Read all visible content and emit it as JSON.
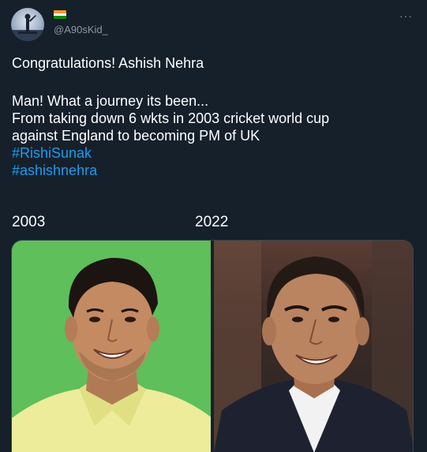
{
  "user": {
    "handle": "@A90sKid_",
    "flag": [
      "#ff9933",
      "#ffffff",
      "#138808"
    ],
    "more_label": "···"
  },
  "tweet": {
    "lines": [
      "Congratulations! Ashish Nehra",
      "Man! What a journey its been...",
      "From taking down 6 wkts in 2003 cricket world cup",
      "against England to becoming PM of UK"
    ],
    "hashtags": [
      "#RishiSunak",
      "#ashishnehra"
    ]
  },
  "media": {
    "left_label": "2003",
    "right_label": "2022"
  },
  "colors": {
    "background": "#15202b",
    "hashtag": "#1d9bf0",
    "muted": "#8b98a5"
  }
}
